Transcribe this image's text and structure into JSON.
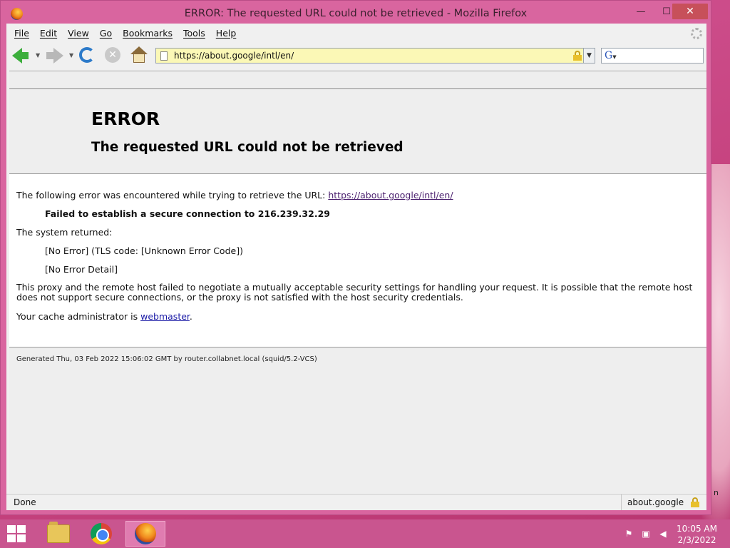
{
  "window": {
    "title": "ERROR: The requested URL could not be retrieved - Mozilla Firefox",
    "minimize": "—",
    "maximize": "☐",
    "close": "✕"
  },
  "menubar": {
    "items": [
      "File",
      "Edit",
      "View",
      "Go",
      "Bookmarks",
      "Tools",
      "Help"
    ]
  },
  "navbar": {
    "url": "https://about.google/intl/en/",
    "search_placeholder": ""
  },
  "page": {
    "title": "ERROR",
    "subtitle": "The requested URL could not be retrieved",
    "intro_text": "The following error was encountered while trying to retrieve the URL: ",
    "intro_link": "https://about.google/intl/en/",
    "failure": "Failed to establish a secure connection to 216.239.32.29",
    "system_returned": "The system returned:",
    "error_line1": "[No Error] (TLS code: [Unknown Error Code])",
    "error_line2": "[No Error Detail]",
    "explanation": "This proxy and the remote host failed to negotiate a mutually acceptable security settings for handling your request. It is possible that the remote host does not support secure connections, or the proxy is not satisfied with the host security credentials.",
    "admin_text": "Your cache administrator is ",
    "admin_link": "webmaster",
    "admin_end": ".",
    "generated": "Generated Thu, 03 Feb 2022 15:06:02 GMT by router.collabnet.local (squid/5.2-VCS)"
  },
  "statusbar": {
    "status": "Done",
    "host": "about.google"
  },
  "taskbar": {
    "time": "10:05 AM",
    "date": "2/3/2022"
  },
  "desktop": {
    "edge_text": "n"
  },
  "colors": {
    "window_frame": "#d9659f",
    "taskbar": "#c9558f",
    "urlbar_secure": "#fbf8b6"
  },
  "icons": [
    "firefox-icon",
    "back-icon",
    "forward-icon",
    "reload-icon",
    "stop-icon",
    "home-icon",
    "lock-icon",
    "google-search-icon",
    "windows-start-icon",
    "folder-icon",
    "chrome-icon",
    "flag-icon",
    "network-icon",
    "volume-muted-icon"
  ]
}
